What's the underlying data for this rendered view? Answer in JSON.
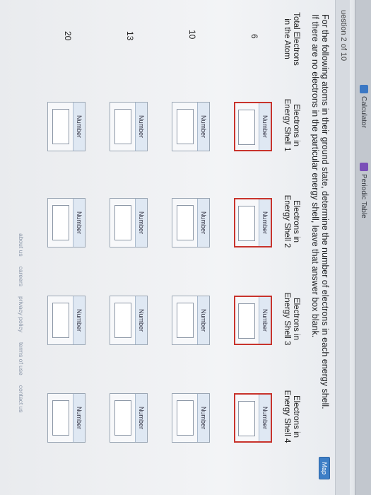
{
  "browser": {
    "tabs": [
      {
        "label": "Calculator",
        "icon": "calculator-icon"
      },
      {
        "label": "Periodic Table",
        "icon": "periodic-table-icon"
      }
    ]
  },
  "question": {
    "label": "uestion 2 of 10",
    "map_button": "Map"
  },
  "instructions": "For the following atoms in their ground state, determine the number of electrons in each energy shell. If there are no electrons in the particular energy shell, leave that answer box blank.",
  "table": {
    "headers": [
      "Total Electrons in the Atom",
      "Electrons in Energy Shell 1",
      "Electrons in Energy Shell 2",
      "Electrons in Energy Shell 3",
      "Electrons in Energy Shell 4"
    ],
    "box_label": "Number",
    "rows": [
      {
        "total": "6",
        "values": [
          "",
          "",
          "",
          ""
        ]
      },
      {
        "total": "10",
        "values": [
          "",
          "",
          "",
          ""
        ]
      },
      {
        "total": "13",
        "values": [
          "",
          "",
          "",
          ""
        ]
      },
      {
        "total": "20",
        "values": [
          "",
          "",
          "",
          ""
        ]
      }
    ]
  },
  "footer": {
    "links": [
      "about us",
      "careers",
      "privacy policy",
      "terms of use",
      "contact us"
    ]
  },
  "colors": {
    "selected_border": "#c8332c",
    "label_bar": "#dfe8f3",
    "map_button": "#3d7ec6"
  }
}
